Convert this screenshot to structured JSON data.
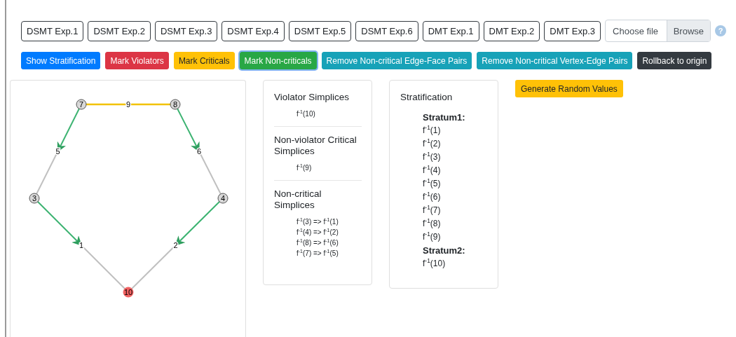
{
  "experiments": [
    {
      "label": "DSMT Exp.1"
    },
    {
      "label": "DSMT Exp.2"
    },
    {
      "label": "DSMT Exp.3"
    },
    {
      "label": "DSMT Exp.4"
    },
    {
      "label": "DSMT Exp.5"
    },
    {
      "label": "DSMT Exp.6"
    },
    {
      "label": "DMT Exp.1"
    },
    {
      "label": "DMT Exp.2"
    },
    {
      "label": "DMT Exp.3"
    }
  ],
  "file_input": {
    "placeholder": "Choose file",
    "button": "Browse"
  },
  "help": "?",
  "actions": [
    {
      "label": "Show Stratification",
      "kind": "primary",
      "focused": false
    },
    {
      "label": "Mark Violators",
      "kind": "danger",
      "focused": false
    },
    {
      "label": "Mark Criticals",
      "kind": "warning",
      "focused": false
    },
    {
      "label": "Mark Non-criticals",
      "kind": "success",
      "focused": true
    },
    {
      "label": "Remove Non-critical Edge-Face Pairs",
      "kind": "info",
      "focused": false
    },
    {
      "label": "Remove Non-critical Vertex-Edge Pairs",
      "kind": "info",
      "focused": false
    },
    {
      "label": "Rollback to origin",
      "kind": "dark",
      "focused": false
    }
  ],
  "graph": {
    "vertices": [
      {
        "label": "3",
        "violator": false
      },
      {
        "label": "4",
        "violator": false
      },
      {
        "label": "7",
        "violator": false
      },
      {
        "label": "8",
        "violator": false
      },
      {
        "label": "10",
        "violator": true
      }
    ],
    "edges": [
      {
        "label": "9",
        "kind": "critical"
      },
      {
        "label": "5",
        "kind": "paired"
      },
      {
        "label": "6",
        "kind": "paired"
      },
      {
        "label": "1",
        "kind": "paired"
      },
      {
        "label": "2",
        "kind": "paired"
      }
    ]
  },
  "simplices": [
    {
      "title": "Violator Simplices",
      "items": [
        "f$^{-1}$(10)"
      ]
    },
    {
      "title": "Non-violator Critical Simplices",
      "items": [
        "f$^{-1}$(9)"
      ]
    },
    {
      "title": "Non-critical Simplices",
      "items": [
        "f$^{-1}$(3) => f$^{-1}$(1)",
        "f$^{-1}$(4) => f$^{-1}$(2)",
        "f$^{-1}$(8) => f$^{-1}$(6)",
        "f$^{-1}$(7) => f$^{-1}$(5)"
      ]
    }
  ],
  "stratification": {
    "title": "Stratification",
    "strata": [
      {
        "name": "Stratum1:",
        "items": [
          "f$^{-1}$(1)",
          "f$^{-1}$(2)",
          "f$^{-1}$(3)",
          "f$^{-1}$(4)",
          "f$^{-1}$(5)",
          "f$^{-1}$(6)",
          "f$^{-1}$(7)",
          "f$^{-1}$(8)",
          "f$^{-1}$(9)"
        ]
      },
      {
        "name": "Stratum2:",
        "items": [
          "f$^{-1}$(10)"
        ]
      }
    ]
  },
  "generate_button": "Generate Random Values"
}
